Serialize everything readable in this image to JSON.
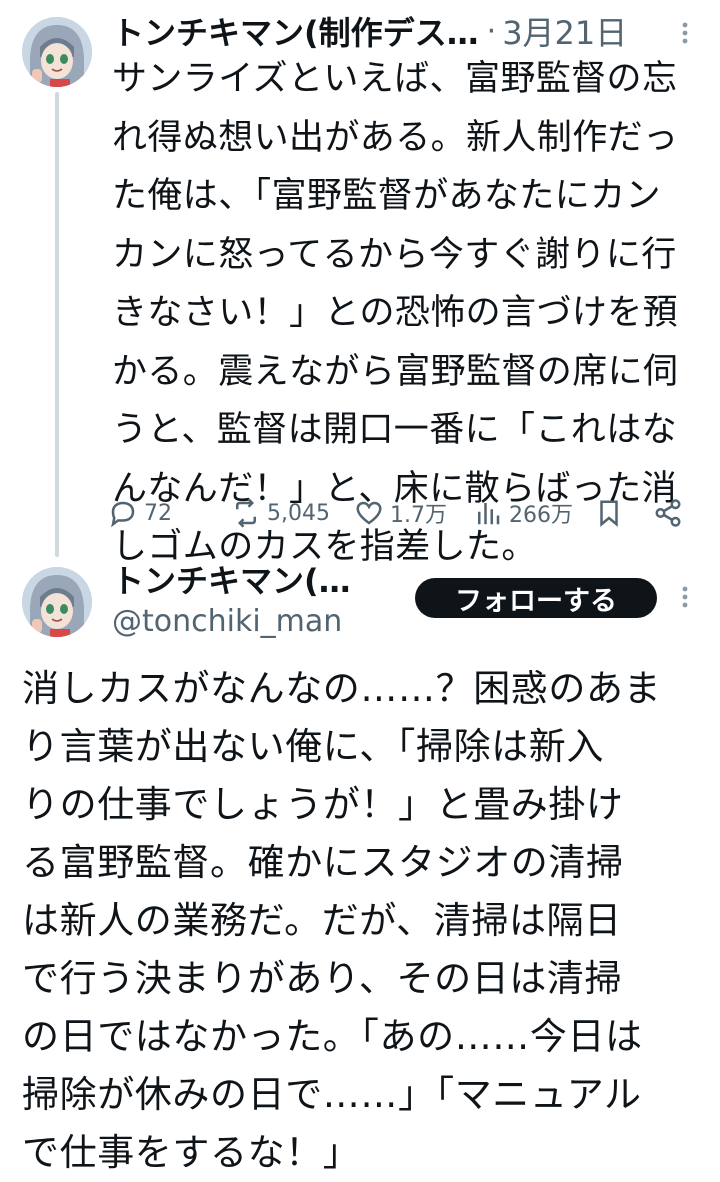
{
  "tweet1": {
    "author_name": "トンチキマン(制作デス…",
    "separator": "·",
    "date": "3月21日",
    "avatar_icon": "anime-character-avatar",
    "more_icon": "more-vertical-icon",
    "text": "サンライズといえば、富野監督の忘\nれ得ぬ想い出がある。新人制作だっ\nた俺は、「富野監督があなたにカン\nカンに怒ってるから今すぐ謝りに行\nきなさい！」との恐怖の言づけを預\nかる。震えながら富野監督の席に伺\nうと、監督は開口一番に「これはな\nんなんだ！」と、床に散らばった消\nしゴムのカスを指差した。",
    "actions": {
      "replies": "72",
      "retweets": "5,045",
      "likes": "1.7万",
      "views": "266万"
    }
  },
  "tweet2": {
    "author_name": "トンチキマン(…",
    "handle": "@tonchiki_man",
    "follow_label": "フォローする",
    "avatar_icon": "anime-character-avatar",
    "more_icon": "more-vertical-icon",
    "text": "消しカスがなんなの……？困惑のあま\nり言葉が出ない俺に、「掃除は新入\nりの仕事でしょうが！」と畳み掛け\nる富野監督。確かにスタジオの清掃\nは新人の業務だ。だが、清掃は隔日\nで行う決まりがあり、その日は清掃\nの日ではなかった。「あの……今日は\n掃除が休みの日で……」「マニュアル\nで仕事をするな！」"
  },
  "colors": {
    "text": "#0f1419",
    "secondary": "#536471",
    "thread_line": "#cfd9de",
    "button_bg": "#0f1419"
  }
}
